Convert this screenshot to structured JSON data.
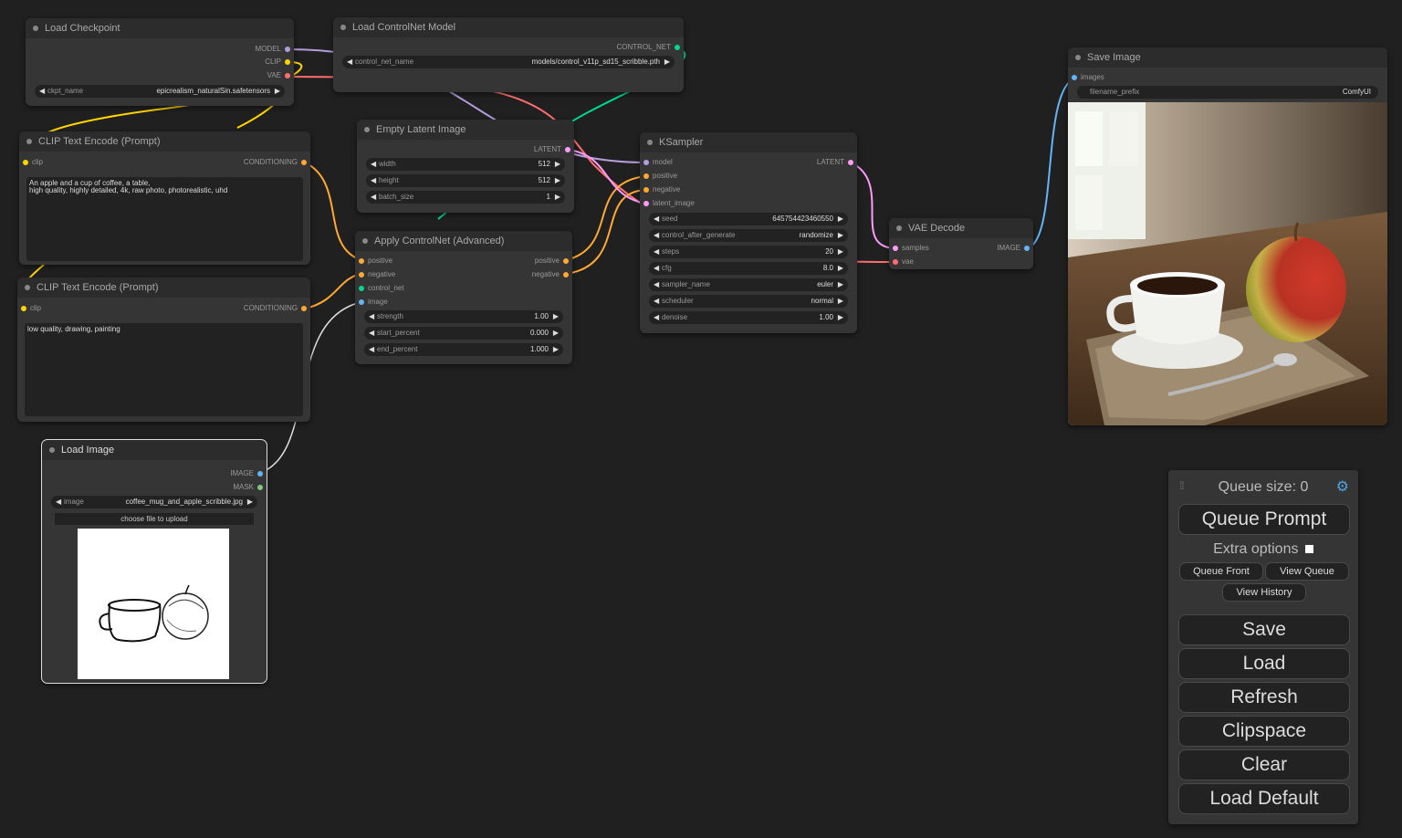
{
  "nodes": {
    "load_checkpoint": {
      "title": "Load Checkpoint",
      "outputs": [
        "MODEL",
        "CLIP",
        "VAE"
      ],
      "widget": {
        "label": "ckpt_name",
        "value": "epicrealism_naturalSin.safetensors"
      }
    },
    "load_controlnet": {
      "title": "Load ControlNet Model",
      "output": "CONTROL_NET",
      "widget": {
        "label": "control_net_name",
        "value": "models/control_v11p_sd15_scribble.pth"
      }
    },
    "save_image": {
      "title": "Save Image",
      "input": "images",
      "widget": {
        "label": "filename_prefix",
        "value": "ComfyUI"
      }
    },
    "clip_pos": {
      "title": "CLIP Text Encode (Prompt)",
      "input": "clip",
      "output": "CONDITIONING",
      "text": "An apple and a cup of coffee, a table,\nhigh quality, highly detailed, 4k, raw photo, photorealistic, uhd"
    },
    "clip_neg": {
      "title": "CLIP Text Encode (Prompt)",
      "input": "clip",
      "output": "CONDITIONING",
      "text": "low quality, drawing, painting"
    },
    "empty_latent": {
      "title": "Empty Latent Image",
      "output": "LATENT",
      "widgets": [
        {
          "label": "width",
          "value": "512"
        },
        {
          "label": "height",
          "value": "512"
        },
        {
          "label": "batch_size",
          "value": "1"
        }
      ]
    },
    "apply_cn": {
      "title": "Apply ControlNet (Advanced)",
      "inputs": [
        "positive",
        "negative",
        "control_net",
        "image"
      ],
      "outputs": [
        "positive",
        "negative"
      ],
      "widgets": [
        {
          "label": "strength",
          "value": "1.00"
        },
        {
          "label": "start_percent",
          "value": "0.000"
        },
        {
          "label": "end_percent",
          "value": "1.000"
        }
      ]
    },
    "ksampler": {
      "title": "KSampler",
      "inputs": [
        "model",
        "positive",
        "negative",
        "latent_image"
      ],
      "output": "LATENT",
      "widgets": [
        {
          "label": "seed",
          "value": "645754423460550"
        },
        {
          "label": "control_after_generate",
          "value": "randomize"
        },
        {
          "label": "steps",
          "value": "20"
        },
        {
          "label": "cfg",
          "value": "8.0"
        },
        {
          "label": "sampler_name",
          "value": "euler"
        },
        {
          "label": "scheduler",
          "value": "normal"
        },
        {
          "label": "denoise",
          "value": "1.00"
        }
      ]
    },
    "vae_decode": {
      "title": "VAE Decode",
      "inputs": [
        "samples",
        "vae"
      ],
      "output": "IMAGE"
    },
    "load_image": {
      "title": "Load Image",
      "outputs": [
        "IMAGE",
        "MASK"
      ],
      "widget": {
        "label": "image",
        "value": "coffee_mug_and_apple_scribble.jpg"
      },
      "upload_label": "choose file to upload"
    }
  },
  "queue": {
    "size_label": "Queue size: 0",
    "queue_prompt": "Queue Prompt",
    "extra_options": "Extra options",
    "queue_front": "Queue Front",
    "view_queue": "View Queue",
    "view_history": "View History",
    "save": "Save",
    "load": "Load",
    "refresh": "Refresh",
    "clipspace": "Clipspace",
    "clear": "Clear",
    "load_default": "Load Default"
  },
  "colors": {
    "model": "#b39ddb",
    "clip": "#ffd500",
    "vae": "#ff6e6e",
    "conditioning": "#ffa931",
    "latent": "#ff9cf9",
    "image": "#64b5f6",
    "control_net": "#00d78d",
    "mask": "#81c784"
  }
}
